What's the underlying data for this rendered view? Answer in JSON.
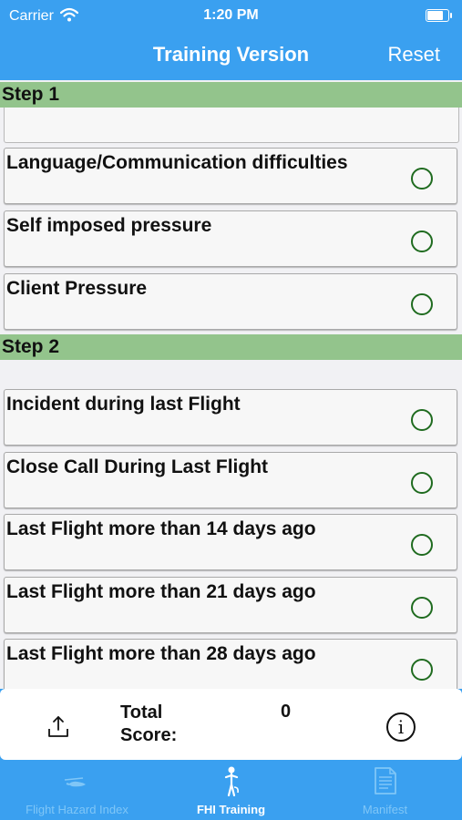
{
  "status_bar": {
    "carrier": "Carrier",
    "time": "1:20 PM"
  },
  "nav": {
    "title": "Training Version",
    "reset_label": "Reset"
  },
  "sections": [
    {
      "header": "Step 1",
      "items": [
        {
          "label": "Language/Communication difficulties",
          "selected": false
        },
        {
          "label": "Self imposed pressure",
          "selected": false
        },
        {
          "label": "Client Pressure",
          "selected": false
        }
      ]
    },
    {
      "header": "Step 2",
      "items": [
        {
          "label": "Incident during last Flight",
          "selected": false
        },
        {
          "label": "Close Call During Last Flight",
          "selected": false
        },
        {
          "label": "Last Flight more than 14 days ago",
          "selected": false
        },
        {
          "label": "Last Flight more than 21 days ago",
          "selected": false
        },
        {
          "label": "Last Flight more than 28 days ago",
          "selected": false
        }
      ]
    }
  ],
  "footer": {
    "score_label": "Total Score:",
    "score_value": "0",
    "share_icon": "share-icon",
    "info_icon": "info-icon"
  },
  "tabs": [
    {
      "label": "Flight Hazard Index",
      "icon": "helicopter-icon",
      "active": false
    },
    {
      "label": "FHI Training",
      "icon": "pilot-icon",
      "active": true
    },
    {
      "label": "Manifest",
      "icon": "document-icon",
      "active": false
    }
  ],
  "colors": {
    "primary": "#3aa0f0",
    "section_header": "#93c48c",
    "radio": "#1f6b1f"
  }
}
